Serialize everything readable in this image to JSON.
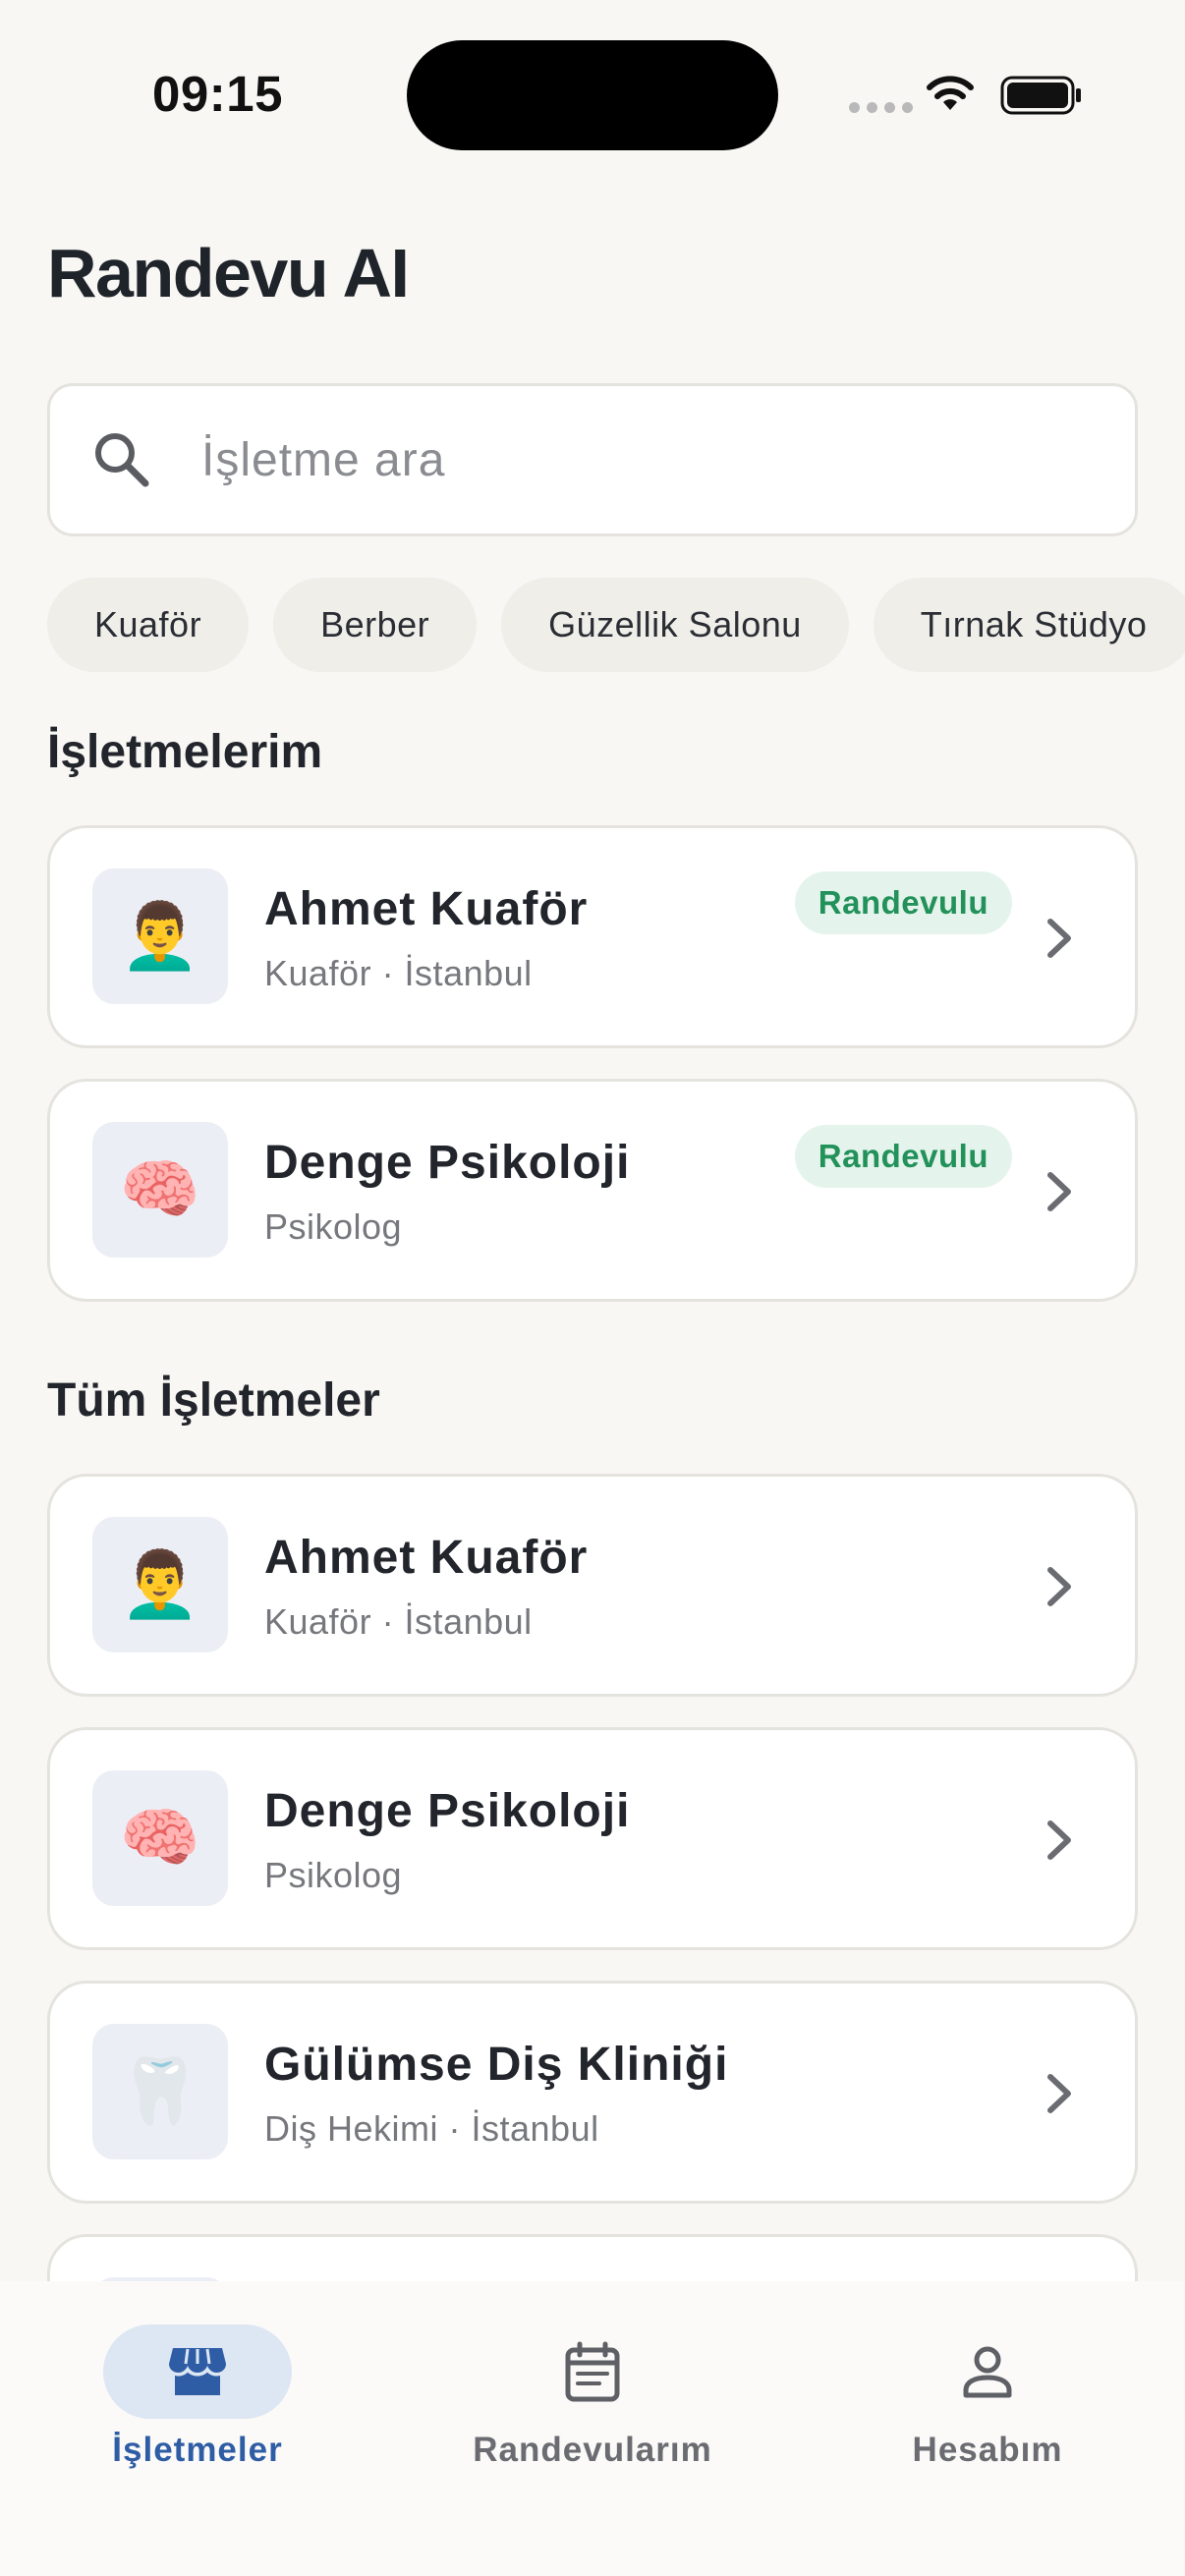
{
  "status_bar": {
    "time": "09:15"
  },
  "header": {
    "title": "Randevu AI"
  },
  "search": {
    "placeholder": "İşletme ara"
  },
  "chips": [
    "Kuaför",
    "Berber",
    "Güzellik Salonu",
    "Tırnak Stüdyo"
  ],
  "sections": {
    "mine_title": "İşletmelerim",
    "all_title": "Tüm İşletmeler"
  },
  "my_businesses": [
    {
      "icon": "👨‍🦱",
      "icon_name": "barber-person-icon",
      "name": "Ahmet Kuaför",
      "subtitle": "Kuaför · İstanbul",
      "badge": "Randevulu"
    },
    {
      "icon": "🧠",
      "icon_name": "brain-icon",
      "name": "Denge Psikoloji",
      "subtitle": "Psikolog",
      "badge": "Randevulu"
    }
  ],
  "all_businesses": [
    {
      "icon": "👨‍🦱",
      "icon_name": "barber-person-icon",
      "name": "Ahmet Kuaför",
      "subtitle": "Kuaför · İstanbul"
    },
    {
      "icon": "🧠",
      "icon_name": "brain-icon",
      "name": "Denge Psikoloji",
      "subtitle": "Psikolog"
    },
    {
      "icon": "🦷",
      "icon_name": "tooth-icon",
      "name": "Gülümse Diş Kliniği",
      "subtitle": "Diş Hekimi · İstanbul"
    }
  ],
  "bottom_nav": [
    {
      "label": "İşletmeler",
      "icon": "store-icon",
      "active": true
    },
    {
      "label": "Randevularım",
      "icon": "calendar-icon",
      "active": false
    },
    {
      "label": "Hesabım",
      "icon": "person-icon",
      "active": false
    }
  ],
  "colors": {
    "accent": "#2f5da5",
    "badge_bg": "#e4f4ec",
    "badge_text": "#22915a",
    "background": "#f8f7f4"
  }
}
